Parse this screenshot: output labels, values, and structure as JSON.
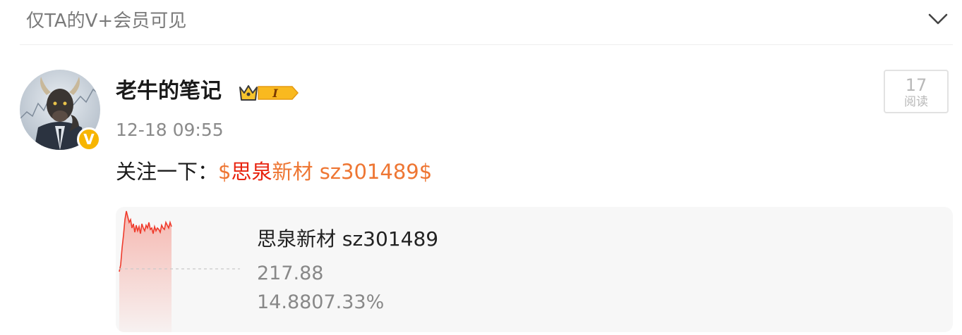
{
  "header": {
    "visibility_text": "仅TA的V+会员可见"
  },
  "post": {
    "author": "老牛的笔记",
    "rank_badge": "I",
    "verified_badge": "V",
    "timestamp": "12-18 09:55",
    "read_count": "17",
    "read_label": "阅读",
    "text_prefix": "关注一下：",
    "stock_link_dollar_open": "$",
    "stock_link_name": "思泉",
    "stock_link_rest": "新材 sz301489$"
  },
  "stock_card": {
    "name": "思泉新材 sz301489",
    "price": "217.88",
    "change": "14.8807.33%"
  },
  "colors": {
    "accent_orange": "#ee7633",
    "stock_red": "#e8220e",
    "badge_gold": "#f7b500"
  },
  "icons": {
    "collapse": "chevron-down-icon",
    "verified": "verified-v-icon",
    "rank": "crown-rank-icon"
  }
}
